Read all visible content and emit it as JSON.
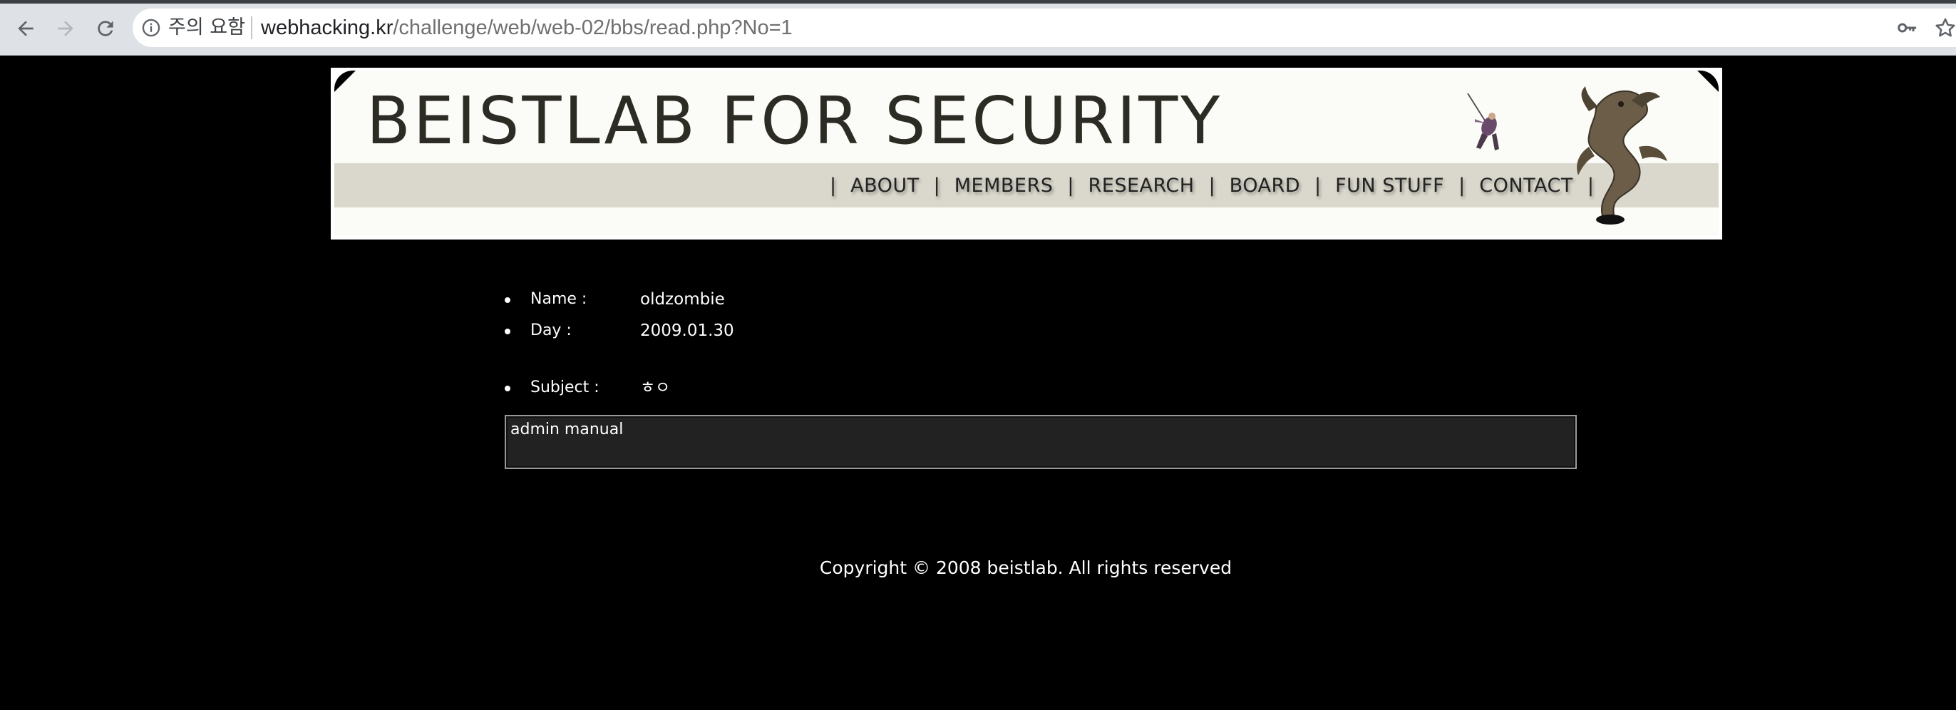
{
  "browser": {
    "security_label": "주의 요함",
    "url_host": "webhacking.kr",
    "url_path": "/challenge/web/web-02/bbs/read.php?No=1"
  },
  "banner": {
    "title": "BEISTLAB FOR SECURITY",
    "nav": [
      "ABOUT",
      "MEMBERS",
      "RESEARCH",
      "BOARD",
      "FUN STUFF",
      "CONTACT"
    ]
  },
  "post": {
    "name_label": "Name :",
    "name_value": "oldzombie",
    "day_label": "Day :",
    "day_value": "2009.01.30",
    "subject_label": "Subject :",
    "subject_value": "ㅎㅇ",
    "content": "admin manual"
  },
  "footer": {
    "copyright": "Copyright © 2008 beistlab. All rights reserved"
  },
  "colors": {
    "page_background": "#000000",
    "banner_bar": "#dad8cc",
    "content_box": "#222222"
  }
}
